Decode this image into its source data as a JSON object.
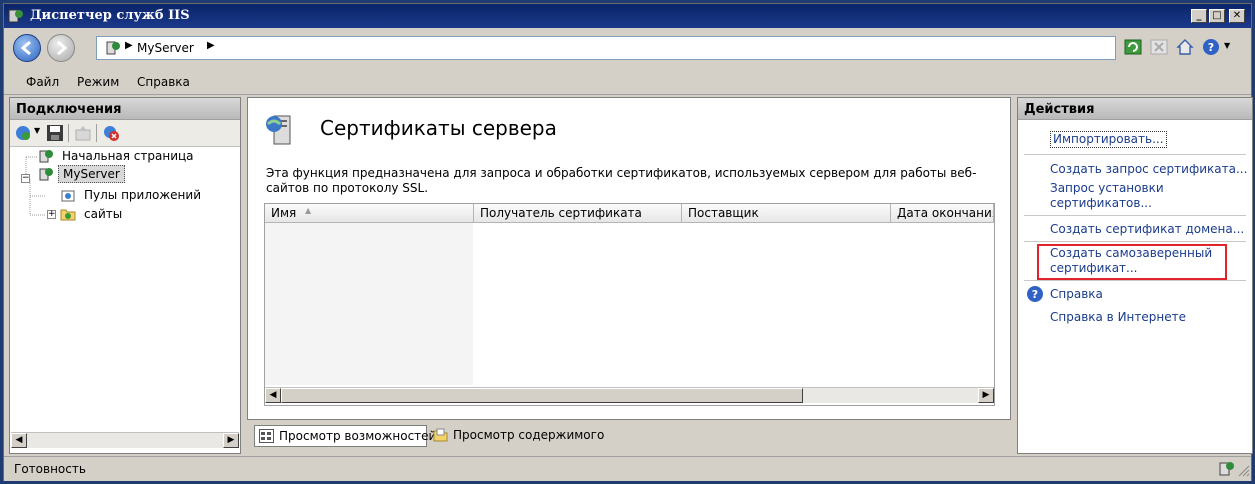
{
  "window": {
    "title": "Диспетчер служб IIS"
  },
  "address": {
    "crumb": "MyServer"
  },
  "menu": {
    "file": "Файл",
    "view": "Режим",
    "help": "Справка"
  },
  "connections": {
    "header": "Подключения",
    "tree": [
      {
        "label": "Начальная страница"
      },
      {
        "label": "MyServer"
      },
      {
        "label": "Пулы приложений"
      },
      {
        "label": "сайты"
      }
    ]
  },
  "main": {
    "title": "Сертификаты сервера",
    "description": "Эта функция предназначена для запроса и обработки сертификатов, используемых сервером для работы веб-сайтов по протоколу SSL.",
    "columns": [
      "Имя",
      "Получатель сертификата",
      "Поставщик",
      "Дата окончания"
    ],
    "view_features": "Просмотр возможностей",
    "view_content": "Просмотр содержимого"
  },
  "actions": {
    "header": "Действия",
    "items": [
      "Импортировать...",
      "Создать запрос сертификата...",
      "Запрос установки сертификатов...",
      "Создать сертификат домена...",
      "Создать самозаверенный сертификат...",
      "Справка",
      "Справка в Интернете"
    ]
  },
  "status": {
    "text": "Готовность"
  }
}
